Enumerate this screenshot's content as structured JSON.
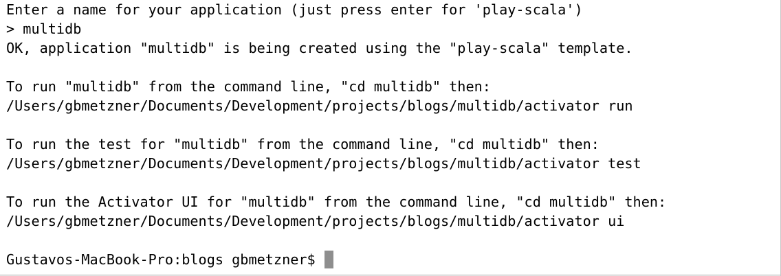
{
  "terminal": {
    "lines": [
      "Enter a name for your application (just press enter for 'play-scala')",
      "> multidb",
      "OK, application \"multidb\" is being created using the \"play-scala\" template.",
      "",
      "To run \"multidb\" from the command line, \"cd multidb\" then:",
      "/Users/gbmetzner/Documents/Development/projects/blogs/multidb/activator run",
      "",
      "To run the test for \"multidb\" from the command line, \"cd multidb\" then:",
      "/Users/gbmetzner/Documents/Development/projects/blogs/multidb/activator test",
      "",
      "To run the Activator UI for \"multidb\" from the command line, \"cd multidb\" then:",
      "/Users/gbmetzner/Documents/Development/projects/blogs/multidb/activator ui",
      ""
    ],
    "prompt": "Gustavos-MacBook-Pro:blogs gbmetzner$",
    "cursor_color": "#8e8e8e",
    "background_color": "#ffffff",
    "text_color": "#000000"
  }
}
